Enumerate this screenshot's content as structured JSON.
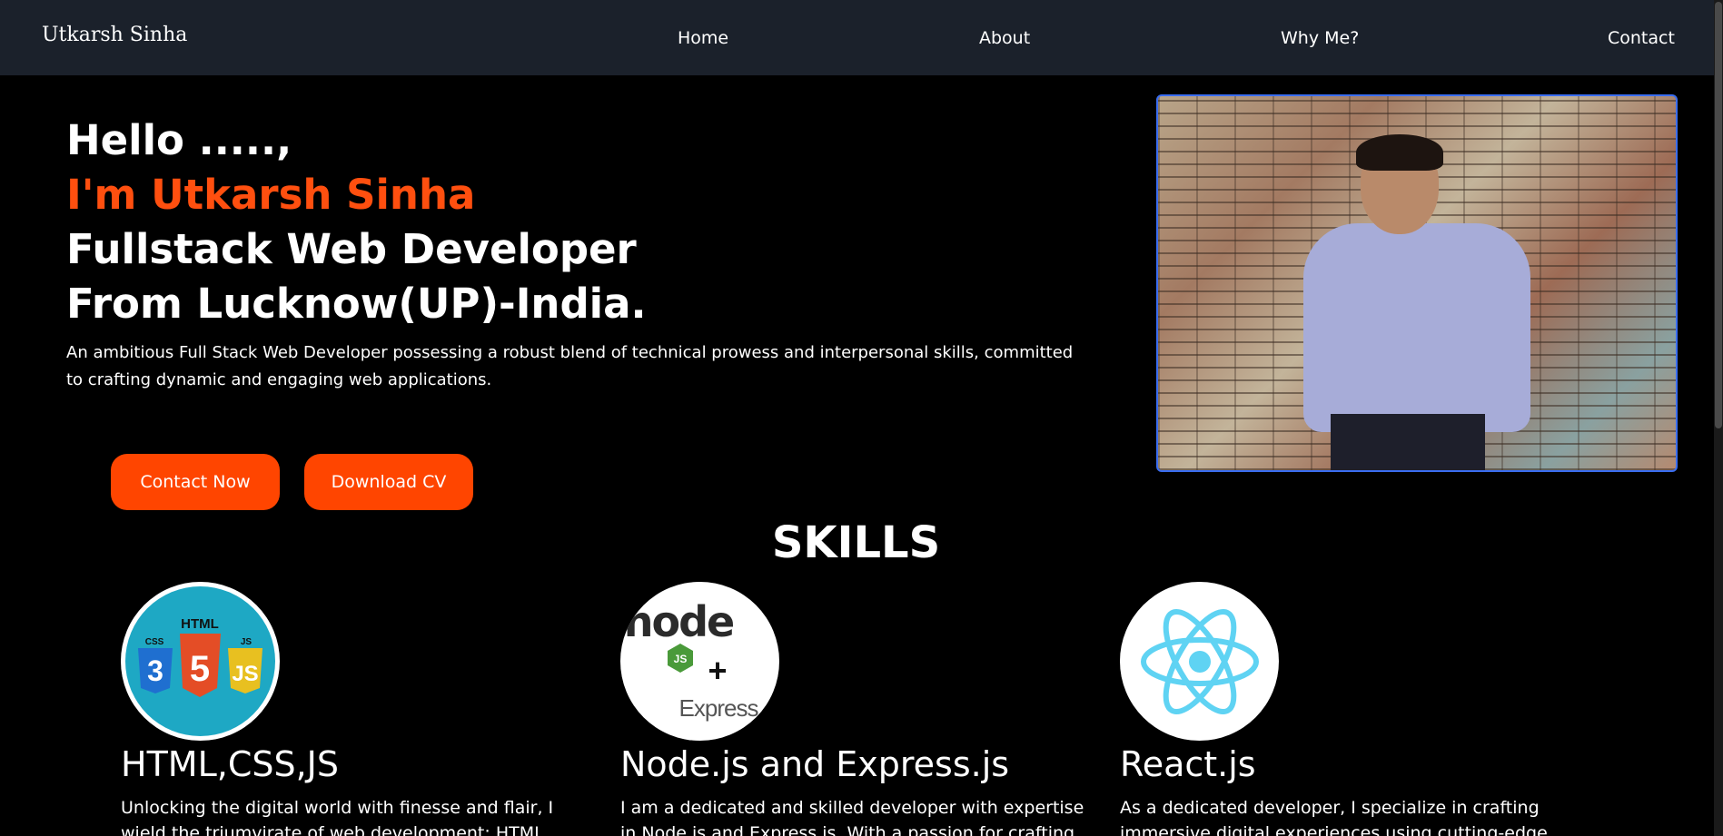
{
  "navbar": {
    "brand": "Utkarsh Sinha",
    "links": [
      "Home",
      "About",
      "Why Me?",
      "Contact"
    ]
  },
  "hero": {
    "greeting": "Hello .....,",
    "name_line": "I'm Utkarsh Sinha",
    "role_line": "Fullstack Web Developer",
    "location_line": "From Lucknow(UP)-India.",
    "description": "An ambitious Full Stack Web Developer possessing a robust blend of technical prowess and interpersonal skills, committed to crafting dynamic and engaging web applications.",
    "contact_button": "Contact Now",
    "download_button": "Download CV"
  },
  "skills": {
    "title": "SKILLS",
    "items": [
      {
        "title": "HTML,CSS,JS",
        "description": "Unlocking the digital world with finesse and flair, I wield the triumvirate of web development: HTML, CSS, and",
        "icon": "html-css-js-logo-icon",
        "logo_labels": [
          "CSS",
          "HTML",
          "JS",
          "3",
          "5",
          "JS"
        ]
      },
      {
        "title": "Node.js and Express.js",
        "description": "I am a dedicated and skilled developer with expertise in Node.js and Express.js. With a passion for crafting robust",
        "icon": "node-express-logo-icon",
        "logo_labels": [
          "node",
          "JS",
          "+",
          "Express"
        ]
      },
      {
        "title": "React.js",
        "description": "As a dedicated developer, I specialize in crafting immersive digital experiences using cutting-edge technologies. With",
        "icon": "react-logo-icon"
      }
    ]
  },
  "colors": {
    "accent": "#ff4500",
    "name_accent": "#ff4f0f",
    "navbar_bg": "#1b212b",
    "page_bg": "#000000",
    "photo_border": "#3a6df0"
  }
}
